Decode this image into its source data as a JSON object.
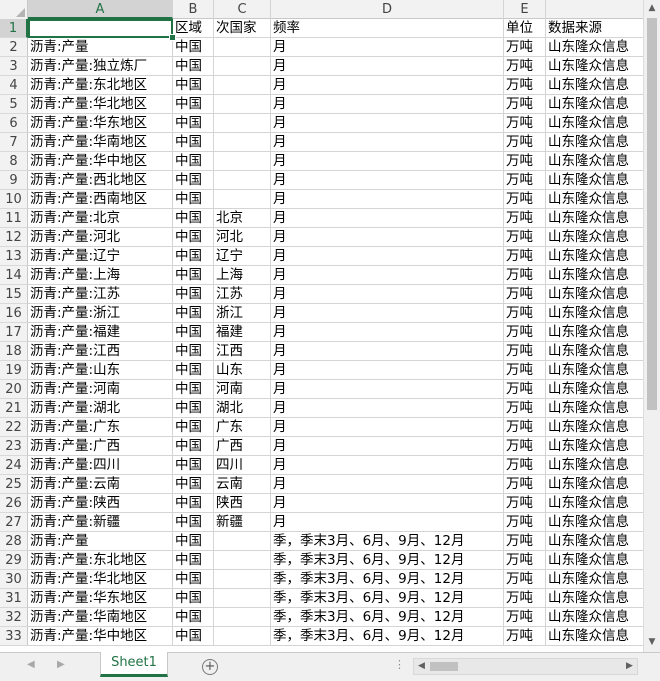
{
  "columns": [
    "A",
    "B",
    "C",
    "D",
    "E",
    ""
  ],
  "rows": [
    [
      "",
      "区域",
      "次国家",
      "频率",
      "单位",
      "数据来源"
    ],
    [
      "沥青:产量",
      "中国",
      "",
      "月",
      "万吨",
      "山东隆众信息"
    ],
    [
      "沥青:产量:独立炼厂",
      "中国",
      "",
      "月",
      "万吨",
      "山东隆众信息"
    ],
    [
      "沥青:产量:东北地区",
      "中国",
      "",
      "月",
      "万吨",
      "山东隆众信息"
    ],
    [
      "沥青:产量:华北地区",
      "中国",
      "",
      "月",
      "万吨",
      "山东隆众信息"
    ],
    [
      "沥青:产量:华东地区",
      "中国",
      "",
      "月",
      "万吨",
      "山东隆众信息"
    ],
    [
      "沥青:产量:华南地区",
      "中国",
      "",
      "月",
      "万吨",
      "山东隆众信息"
    ],
    [
      "沥青:产量:华中地区",
      "中国",
      "",
      "月",
      "万吨",
      "山东隆众信息"
    ],
    [
      "沥青:产量:西北地区",
      "中国",
      "",
      "月",
      "万吨",
      "山东隆众信息"
    ],
    [
      "沥青:产量:西南地区",
      "中国",
      "",
      "月",
      "万吨",
      "山东隆众信息"
    ],
    [
      "沥青:产量:北京",
      "中国",
      "北京",
      "月",
      "万吨",
      "山东隆众信息"
    ],
    [
      "沥青:产量:河北",
      "中国",
      "河北",
      "月",
      "万吨",
      "山东隆众信息"
    ],
    [
      "沥青:产量:辽宁",
      "中国",
      "辽宁",
      "月",
      "万吨",
      "山东隆众信息"
    ],
    [
      "沥青:产量:上海",
      "中国",
      "上海",
      "月",
      "万吨",
      "山东隆众信息"
    ],
    [
      "沥青:产量:江苏",
      "中国",
      "江苏",
      "月",
      "万吨",
      "山东隆众信息"
    ],
    [
      "沥青:产量:浙江",
      "中国",
      "浙江",
      "月",
      "万吨",
      "山东隆众信息"
    ],
    [
      "沥青:产量:福建",
      "中国",
      "福建",
      "月",
      "万吨",
      "山东隆众信息"
    ],
    [
      "沥青:产量:江西",
      "中国",
      "江西",
      "月",
      "万吨",
      "山东隆众信息"
    ],
    [
      "沥青:产量:山东",
      "中国",
      "山东",
      "月",
      "万吨",
      "山东隆众信息"
    ],
    [
      "沥青:产量:河南",
      "中国",
      "河南",
      "月",
      "万吨",
      "山东隆众信息"
    ],
    [
      "沥青:产量:湖北",
      "中国",
      "湖北",
      "月",
      "万吨",
      "山东隆众信息"
    ],
    [
      "沥青:产量:广东",
      "中国",
      "广东",
      "月",
      "万吨",
      "山东隆众信息"
    ],
    [
      "沥青:产量:广西",
      "中国",
      "广西",
      "月",
      "万吨",
      "山东隆众信息"
    ],
    [
      "沥青:产量:四川",
      "中国",
      "四川",
      "月",
      "万吨",
      "山东隆众信息"
    ],
    [
      "沥青:产量:云南",
      "中国",
      "云南",
      "月",
      "万吨",
      "山东隆众信息"
    ],
    [
      "沥青:产量:陕西",
      "中国",
      "陕西",
      "月",
      "万吨",
      "山东隆众信息"
    ],
    [
      "沥青:产量:新疆",
      "中国",
      "新疆",
      "月",
      "万吨",
      "山东隆众信息"
    ],
    [
      "沥青:产量",
      "中国",
      "",
      "季，季末3月、6月、9月、12月",
      "万吨",
      "山东隆众信息"
    ],
    [
      "沥青:产量:东北地区",
      "中国",
      "",
      "季，季末3月、6月、9月、12月",
      "万吨",
      "山东隆众信息"
    ],
    [
      "沥青:产量:华北地区",
      "中国",
      "",
      "季，季末3月、6月、9月、12月",
      "万吨",
      "山东隆众信息"
    ],
    [
      "沥青:产量:华东地区",
      "中国",
      "",
      "季，季末3月、6月、9月、12月",
      "万吨",
      "山东隆众信息"
    ],
    [
      "沥青:产量:华南地区",
      "中国",
      "",
      "季，季末3月、6月、9月、12月",
      "万吨",
      "山东隆众信息"
    ],
    [
      "沥青:产量:华中地区",
      "中国",
      "",
      "季，季末3月、6月、9月、12月",
      "万吨",
      "山东隆众信息"
    ]
  ],
  "sheet_tab": "Sheet1",
  "add_sheet_symbol": "+",
  "colors": {
    "accent": "#217346"
  }
}
